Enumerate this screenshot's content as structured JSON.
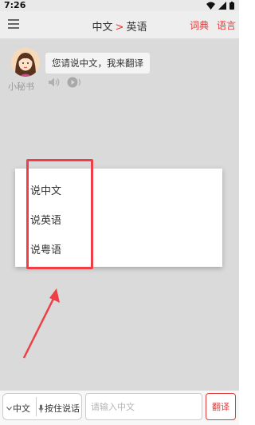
{
  "status_bar": {
    "time": "7:26"
  },
  "header": {
    "source_lang": "中文",
    "separator": ">",
    "target_lang": "英语",
    "dictionary_link": "词典",
    "language_link": "语言"
  },
  "chat": {
    "assistant_name": "小秘书",
    "greeting": "您请说中文，我来翻译"
  },
  "language_menu": {
    "options": [
      "说中文",
      "说英语",
      "说粤语"
    ]
  },
  "annotation": {
    "color": "#ef3e45"
  },
  "bottom_bar": {
    "language_selected": "中文",
    "push_to_talk": "按住说话",
    "input_placeholder": "请输入中文",
    "translate_label": "翻译"
  },
  "colors": {
    "accent": "#e23a3a",
    "overlay_background": "#dadada"
  },
  "icons": [
    "hamburger-menu-icon",
    "wifi-icon",
    "signal-icon",
    "battery-icon",
    "speaker-icon",
    "play-icon",
    "chevron-down-icon",
    "microphone-icon"
  ]
}
